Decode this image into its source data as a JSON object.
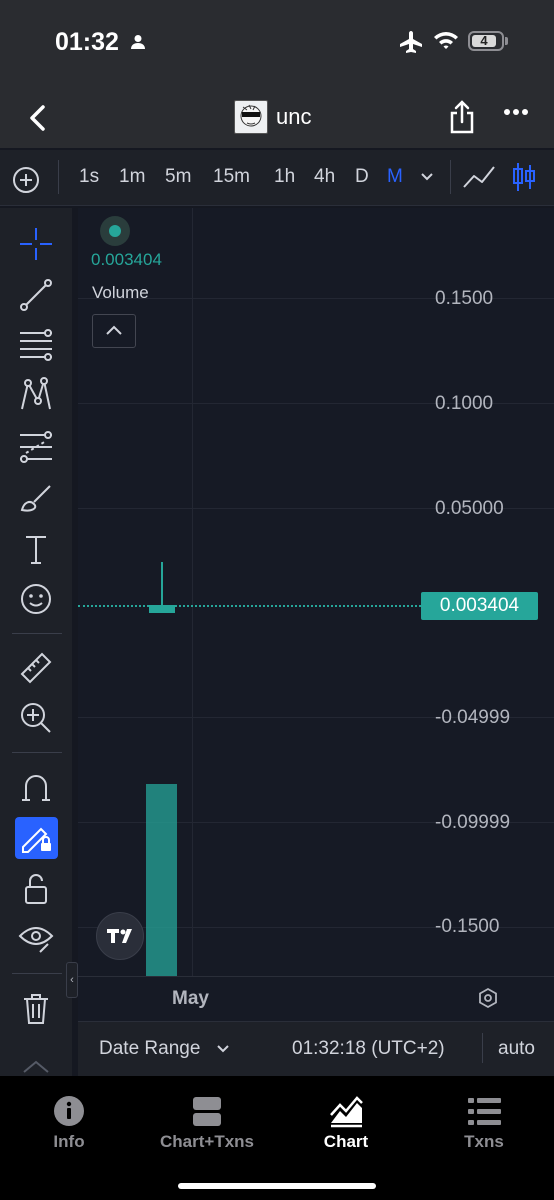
{
  "status_bar": {
    "time": "01:32",
    "battery": "4"
  },
  "header": {
    "token_name": "unc"
  },
  "timeframes": [
    {
      "label": "1s",
      "active": false
    },
    {
      "label": "1m",
      "active": false
    },
    {
      "label": "5m",
      "active": false
    },
    {
      "label": "15m",
      "active": false
    },
    {
      "label": "1h",
      "active": false
    },
    {
      "label": "4h",
      "active": false
    },
    {
      "label": "D",
      "active": false
    },
    {
      "label": "M",
      "active": true
    }
  ],
  "legend": {
    "value": "0.003404",
    "volume_label": "Volume"
  },
  "price_axis": {
    "ticks": [
      "0.1500",
      "0.1000",
      "0.05000",
      "-0.04999",
      "-0.09999",
      "-0.1500"
    ],
    "current_price": "0.003404"
  },
  "time_axis": {
    "label": "May"
  },
  "bottom_bar": {
    "date_range": "Date Range",
    "clock": "01:32:18 (UTC+2)",
    "scale": "auto"
  },
  "tabs": [
    {
      "label": "Info",
      "icon": "info-icon",
      "active": false
    },
    {
      "label": "Chart+Txns",
      "icon": "split-view-icon",
      "active": false
    },
    {
      "label": "Chart",
      "icon": "area-chart-icon",
      "active": true
    },
    {
      "label": "Txns",
      "icon": "list-icon",
      "active": false
    }
  ],
  "colors": {
    "up": "#26a69a",
    "accent": "#2962ff",
    "background": "#151821"
  },
  "chart_data": {
    "type": "candlestick",
    "x": [
      "May"
    ],
    "ohlc": [
      {
        "open": 0.0,
        "high": 0.042,
        "low": 0.0,
        "close": 0.003404
      }
    ],
    "current_price": 0.003404,
    "ylim": [
      -0.17,
      0.17
    ],
    "yticks": [
      0.15,
      0.1,
      0.05,
      -0.04999,
      -0.09999,
      -0.15
    ],
    "grid": true
  }
}
